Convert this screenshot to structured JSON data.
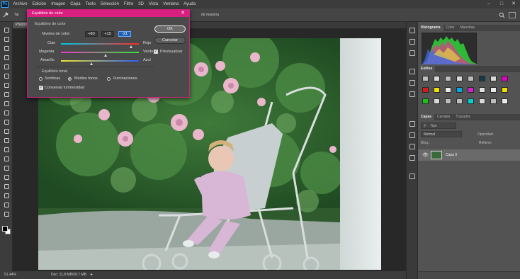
{
  "app": {
    "logo": "Ps",
    "menu": [
      "Archivo",
      "Edición",
      "Imagen",
      "Capa",
      "Texto",
      "Selección",
      "Filtro",
      "3D",
      "Vista",
      "Ventana",
      "Ayuda"
    ]
  },
  "optionsbar": {
    "tool_label": "Tar",
    "sample_text": "de muestra"
  },
  "document": {
    "tab_label": "P50208"
  },
  "status": {
    "zoom": "51,44%",
    "doc_size": "Doc: 11,8 MB/30,7 MB"
  },
  "dialog": {
    "title": "Equilibrio de color",
    "group_color_balance": "Equilibrio de color",
    "levels_label": "Niveles de color:",
    "levels": [
      "+80",
      "+15",
      "-21"
    ],
    "sliders": [
      {
        "left": "Cian",
        "right": "Rojo",
        "value": 80
      },
      {
        "left": "Magenta",
        "right": "Verde",
        "value": 15
      },
      {
        "left": "Amarillo",
        "right": "Azul",
        "value": -21
      }
    ],
    "group_tonal": "Equilibrio tonal",
    "tones": [
      "Sombras",
      "Medios tonos",
      "Iluminaciones"
    ],
    "selected_tone": "Medios tonos",
    "preserve_luminosity": "Conservar luminosidad",
    "ok": "OK",
    "cancel": "Cancelar",
    "preview": "Previsualizar"
  },
  "panels": {
    "histogram_tabs": [
      "Histograma",
      "Color",
      "Muestras"
    ],
    "styles_tabs": [
      "Estilos"
    ],
    "layers_tabs": [
      "Capas",
      "Canales",
      "Trazados"
    ],
    "layers_search": "Tipo",
    "blend_mode": "Normal",
    "opacity_label": "Opacidad:",
    "fill_label": "Relleno:",
    "lock_label": "Bloq.:",
    "layer_name": "Capa 0"
  },
  "colors": {
    "accent": "#d91f80",
    "focus_blue": "#1d5fb3"
  }
}
